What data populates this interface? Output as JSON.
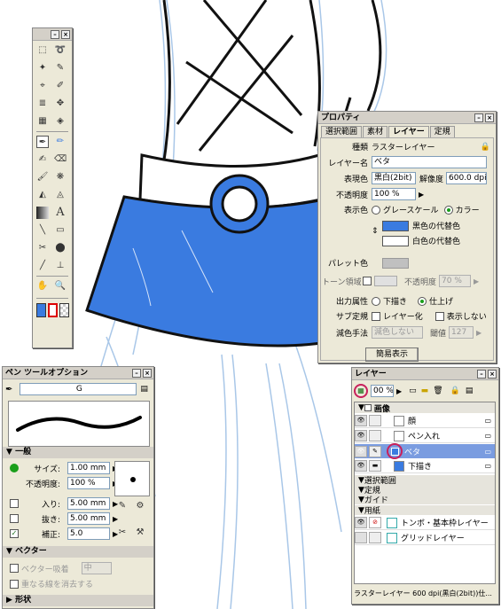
{
  "properties": {
    "title": "プロパティ",
    "tabs": [
      "選択範囲",
      "素材",
      "レイヤー",
      "定規"
    ],
    "kind_label": "種類",
    "kind_value": "ラスターレイヤー",
    "layer_name_label": "レイヤー名",
    "layer_name_value": "ベタ",
    "expression_color_label": "表現色",
    "expression_color_value": "黒白(2bit)",
    "resolution_label": "解像度",
    "resolution_value": "600.0 dpi",
    "opacity_label": "不透明度",
    "opacity_value": "100 %",
    "display_color_label": "表示色",
    "grayscale_label": "グレースケール",
    "color_label": "カラー",
    "black_sub_label": "黒色の代替色",
    "white_sub_label": "白色の代替色",
    "black_sub_color": "#3a7be0",
    "palette_label": "パレット色",
    "tone_area_label": "トーン領域",
    "tone_opacity_label": "不透明度",
    "tone_opacity_value": "70 %",
    "output_label": "出力属性",
    "draft_label": "下描き",
    "finish_label": "仕上げ",
    "sub_ruler_label": "サブ定規",
    "layerize_label": "レイヤー化",
    "hide_label": "表示しない",
    "subtractive_label": "減色手法",
    "subtractive_value": "減色しない",
    "threshold_label": "閾値",
    "threshold_value": "127",
    "simple_display_button": "簡易表示"
  },
  "pen_options": {
    "title": "ペン ツールオプション",
    "brush_name": "G",
    "general_section": "一般",
    "size_label": "サイズ:",
    "size_value": "1.00 mm",
    "opacity_label": "不透明度:",
    "opacity_value": "100 %",
    "in_label": "入り:",
    "in_value": "5.00 mm",
    "out_label": "抜き:",
    "out_value": "5.00 mm",
    "correction_label": "補正:",
    "correction_value": "5.0",
    "vector_section": "ベクター",
    "vector_snap_label": "ベクター吸着",
    "vector_snap_value": "中",
    "erase_overlap_label": "重なる線を消去する",
    "shape_section": "形状"
  },
  "layers": {
    "title": "レイヤー",
    "opacity_value": "00 %",
    "group_pages": "画像",
    "rows": [
      {
        "name": "顔"
      },
      {
        "name": "ペン入れ"
      },
      {
        "name": "ベタ"
      },
      {
        "name": "下描き"
      }
    ],
    "group_selection": "選択範囲",
    "group_ruler": "定規",
    "group_guide": "ガイド",
    "group_paper": "用紙",
    "paper_rows": [
      {
        "name": "トンボ・基本枠レイヤー"
      },
      {
        "name": "グリッドレイヤー"
      }
    ],
    "status": "ラスターレイヤー 600 dpi(黒白(2bit))仕..."
  },
  "colors": {
    "skirt_blue": "#3a7be0",
    "line_black": "#111111",
    "sketch_blue": "#a9c7e8",
    "panel_bg": "#ece9d8",
    "highlight_red": "#c8205c"
  }
}
